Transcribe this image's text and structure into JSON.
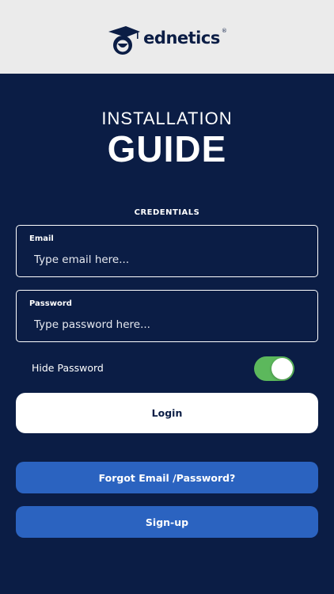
{
  "brand": {
    "name": "ednetics",
    "registered_mark": "®",
    "logo_icon": "owl-graduation-cap-icon",
    "color": "#0b1d45"
  },
  "title": {
    "line1": "INSTALLATION",
    "line2": "GUIDE"
  },
  "credentials": {
    "section_label": "CREDENTIALS",
    "email": {
      "label": "Email",
      "placeholder": "Type email here...",
      "value": ""
    },
    "password": {
      "label": "Password",
      "placeholder": "Type password here...",
      "value": ""
    }
  },
  "hide_password": {
    "label": "Hide Password",
    "enabled": true,
    "on_color": "#5cb85c"
  },
  "buttons": {
    "login": "Login",
    "forgot": "Forgot Email /Password?",
    "signup": "Sign-up"
  },
  "colors": {
    "background": "#0b1d45",
    "header": "#ebebeb",
    "accent_button": "#2b63c0"
  }
}
